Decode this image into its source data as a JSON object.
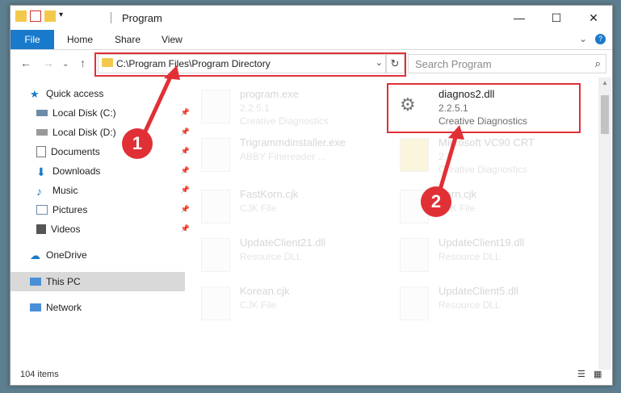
{
  "window": {
    "title": "Program"
  },
  "ribbon": {
    "file_label": "File",
    "home_label": "Home",
    "share_label": "Share",
    "view_label": "View"
  },
  "address": {
    "path": "C:\\Program Files\\Program Directory"
  },
  "search": {
    "placeholder": "Search Program"
  },
  "sidebar": {
    "items": [
      {
        "label": "Quick access"
      },
      {
        "label": "Local Disk (C:)"
      },
      {
        "label": "Local Disk (D:)"
      },
      {
        "label": "Documents"
      },
      {
        "label": "Downloads"
      },
      {
        "label": "Music"
      },
      {
        "label": "Pictures"
      },
      {
        "label": "Videos"
      },
      {
        "label": "OneDrive"
      },
      {
        "label": "This PC"
      },
      {
        "label": "Network"
      }
    ]
  },
  "files": [
    {
      "name": "program.exe",
      "line1": "2.2.5.1",
      "line2": "Creative Diagnostics"
    },
    {
      "name": "diagnos2.dll",
      "line1": "2.2.5.1",
      "line2": "Creative Diagnostics"
    },
    {
      "name": "Trigrammdinstaller.exe",
      "line1": "ABBY Finereader ...",
      "line2": ""
    },
    {
      "name": "Microsoft VC90 CRT",
      "line1": "2.2.",
      "line2": "Creative Diagnostics"
    },
    {
      "name": "FastKorn.cjk",
      "line1": "CJK File",
      "line2": ""
    },
    {
      "name": "Korn.cjk",
      "line1": "CJK File",
      "line2": ""
    },
    {
      "name": "UpdateClient21.dll",
      "line1": "Resource DLL",
      "line2": ""
    },
    {
      "name": "UpdateClient19.dll",
      "line1": "Resource DLL",
      "line2": ""
    },
    {
      "name": "Korean.cjk",
      "line1": "CJK File",
      "line2": ""
    },
    {
      "name": "UpdateClient5.dll",
      "line1": "Resource DLL",
      "line2": ""
    }
  ],
  "status": {
    "count": "104 items"
  },
  "callouts": {
    "one": "1",
    "two": "2"
  },
  "colors": {
    "accent": "#1979ca",
    "highlight": "#e03036"
  }
}
